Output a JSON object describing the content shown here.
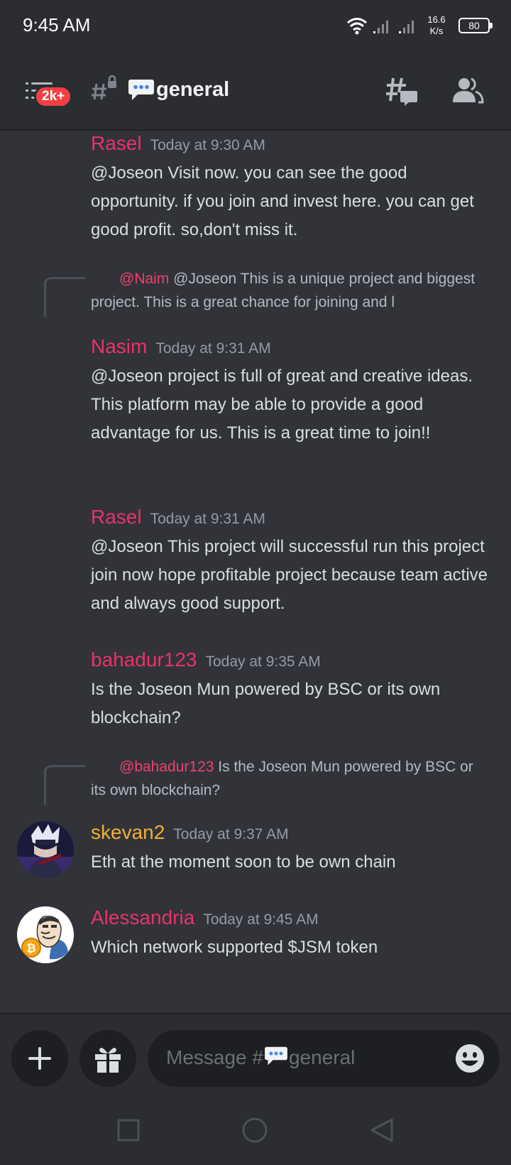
{
  "status_bar": {
    "time": "9:45 AM",
    "speed_value": "16.6",
    "speed_unit": "K/s",
    "battery": "80"
  },
  "header": {
    "notification_badge": "2k+",
    "channel_name": "general",
    "icons": [
      "hamburger-icon",
      "locked-channel-icon",
      "speech-bubble-icon",
      "threads-icon",
      "members-icon"
    ]
  },
  "messages": [
    {
      "author": "Rasel",
      "author_color": "#e8336a",
      "time": "Today at 9:30 AM",
      "text": "@Joseon Visit now. you can see the good opportunity. if you join and invest here. you can get good profit. so,don't miss it."
    },
    {
      "reply": {
        "mention": "@Naim",
        "text": " @Joseon This is a unique project and biggest project. This is a great chance for joining and l"
      },
      "author": "Nasim",
      "author_color": "#e8336a",
      "time": "Today at 9:31 AM",
      "text": "@Joseon  project is full of great and creative ideas. This platform may be able to provide a good advantage for us. This is a great time to join!!"
    },
    {
      "author": "Rasel",
      "author_color": "#e8336a",
      "time": "Today at 9:31 AM",
      "text": "@Joseon This project will successful run this project join now hope profitable project because team active and always good support."
    },
    {
      "author": "bahadur123",
      "author_color": "#e8336a",
      "time": "Today at 9:35 AM",
      "text": "Is the Joseon Mun powered by BSC or its own blockchain?"
    },
    {
      "reply": {
        "mention": "@bahadur123",
        "text": " Is the Joseon Mun powered by BSC or its own blockchain?"
      },
      "author": "skevan2",
      "author_color": "#f0b232",
      "time": "Today at 9:37 AM",
      "text": "Eth at the moment soon to be own chain"
    },
    {
      "author": "Alessandria",
      "author_color": "#e8336a",
      "time": "Today at 9:45 AM",
      "text": "Which network supported $JSM token"
    }
  ],
  "composer": {
    "placeholder_prefix": "Message #",
    "placeholder_channel": "general"
  }
}
